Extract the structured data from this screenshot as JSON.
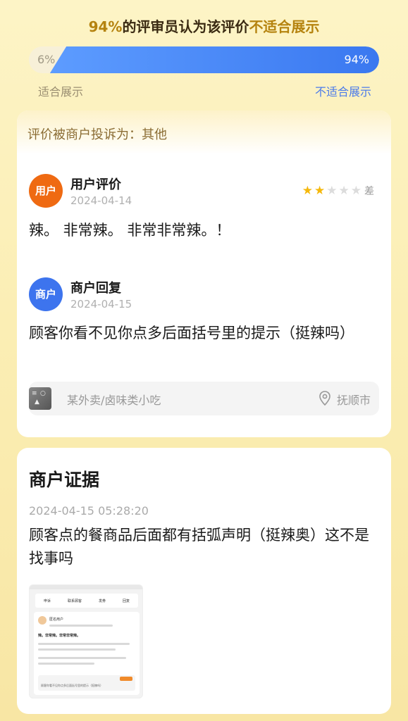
{
  "header": {
    "percent": "94%",
    "middle": "的评审员认为该评价",
    "verdict": "不适合展示"
  },
  "vote": {
    "suitable_pct_text": "6%",
    "unsuitable_pct_text": "94%",
    "unsuitable_fraction": 0.94,
    "suitable_label": "适合展示",
    "unsuitable_label": "不适合展示"
  },
  "complaint": {
    "title": "评价被商户投诉为：其他"
  },
  "user_review": {
    "avatar_label": "用户",
    "title": "用户评价",
    "date": "2024-04-14",
    "rating_stars": 2,
    "rating_max": 5,
    "rating_label": "差",
    "text": "辣。 非常辣。 非常非常辣。！"
  },
  "merchant_reply": {
    "avatar_label": "商户",
    "title": "商户回复",
    "date": "2024-04-15",
    "text": "顾客你看不见你点多后面括号里的提示（挺辣吗）"
  },
  "shop": {
    "name": "某外卖/卤味类小吃",
    "city": "抚顺市",
    "location_icon": "location-pin-icon"
  },
  "evidence": {
    "title": "商户证据",
    "timestamp": "2024-04-15 05:28:20",
    "text": "顾客点的餐商品后面都有括弧声明（挺辣奥）这不是找事吗",
    "screenshot": {
      "tabs": [
        "申诉",
        "联系顾客",
        "发券",
        "回复"
      ],
      "user_name": "匿名用户",
      "review_line": "辣。非常辣。非常非常辣。",
      "reply_line": "顾客你看不见你点多后面括号里的提示（挺辣吗）"
    }
  },
  "colors": {
    "accent_gold": "#b5830f",
    "vote_blue": "#3a78f0",
    "user_orange": "#ef6a12",
    "merchant_blue": "#3d74ee",
    "star_yellow": "#f5b80c"
  }
}
